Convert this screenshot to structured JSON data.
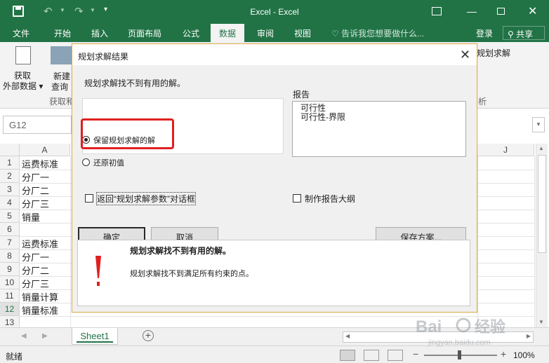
{
  "window": {
    "title": "Excel - Excel"
  },
  "menu": {
    "tabs": [
      "文件",
      "开始",
      "插入",
      "页面布局",
      "公式",
      "数据",
      "审阅",
      "视图"
    ],
    "active_tab": "数据",
    "tell_me": "告诉我您想要做什么...",
    "login": "登录",
    "share": "共享"
  },
  "ribbon": {
    "get_external_l1": "获取",
    "get_external_l2": "外部数据",
    "new_query_l1": "新建",
    "new_query_l2": "查询",
    "get_transform_group": "获取和",
    "solver_partial": "规划求解",
    "analysis_group_partial": "析"
  },
  "formula_bar": {
    "name_box": "G12"
  },
  "sheet": {
    "columns": [
      "A",
      "J"
    ],
    "rows": [
      {
        "num": "1",
        "a": "运费标准"
      },
      {
        "num": "2",
        "a": "分厂一"
      },
      {
        "num": "3",
        "a": "分厂二"
      },
      {
        "num": "4",
        "a": "分厂三"
      },
      {
        "num": "5",
        "a": "销量"
      },
      {
        "num": "6",
        "a": ""
      },
      {
        "num": "7",
        "a": "运费标准"
      },
      {
        "num": "8",
        "a": "分厂一"
      },
      {
        "num": "9",
        "a": "分厂二"
      },
      {
        "num": "10",
        "a": "分厂三"
      },
      {
        "num": "11",
        "a": "销量计算"
      },
      {
        "num": "12",
        "a": "销量标准"
      },
      {
        "num": "13",
        "a": ""
      }
    ],
    "selected_row": "12",
    "tab": "Sheet1"
  },
  "status": {
    "text": "就绪",
    "zoom": "100%"
  },
  "watermark": "Bai经验 jingyan.baidu.com",
  "dialog": {
    "title": "规划求解结果",
    "message": "规划求解找不到有用的解。",
    "radio_keep": "保留规划求解的解",
    "radio_restore": "还原初值",
    "return_checkbox": "返回“规划求解参数”对话框",
    "outline_checkbox": "制作报告大纲",
    "reports_label": "报告",
    "reports": [
      "可行性",
      "可行性-界限"
    ],
    "ok": "确定",
    "cancel": "取消",
    "save_scenario": "保存方案...",
    "info_title": "规划求解找不到有用的解。",
    "info_text": "规划求解找不到满足所有约束的点。"
  },
  "colors": {
    "brand": "#217346",
    "highlight": "#e02020",
    "warning": "#e02020"
  }
}
